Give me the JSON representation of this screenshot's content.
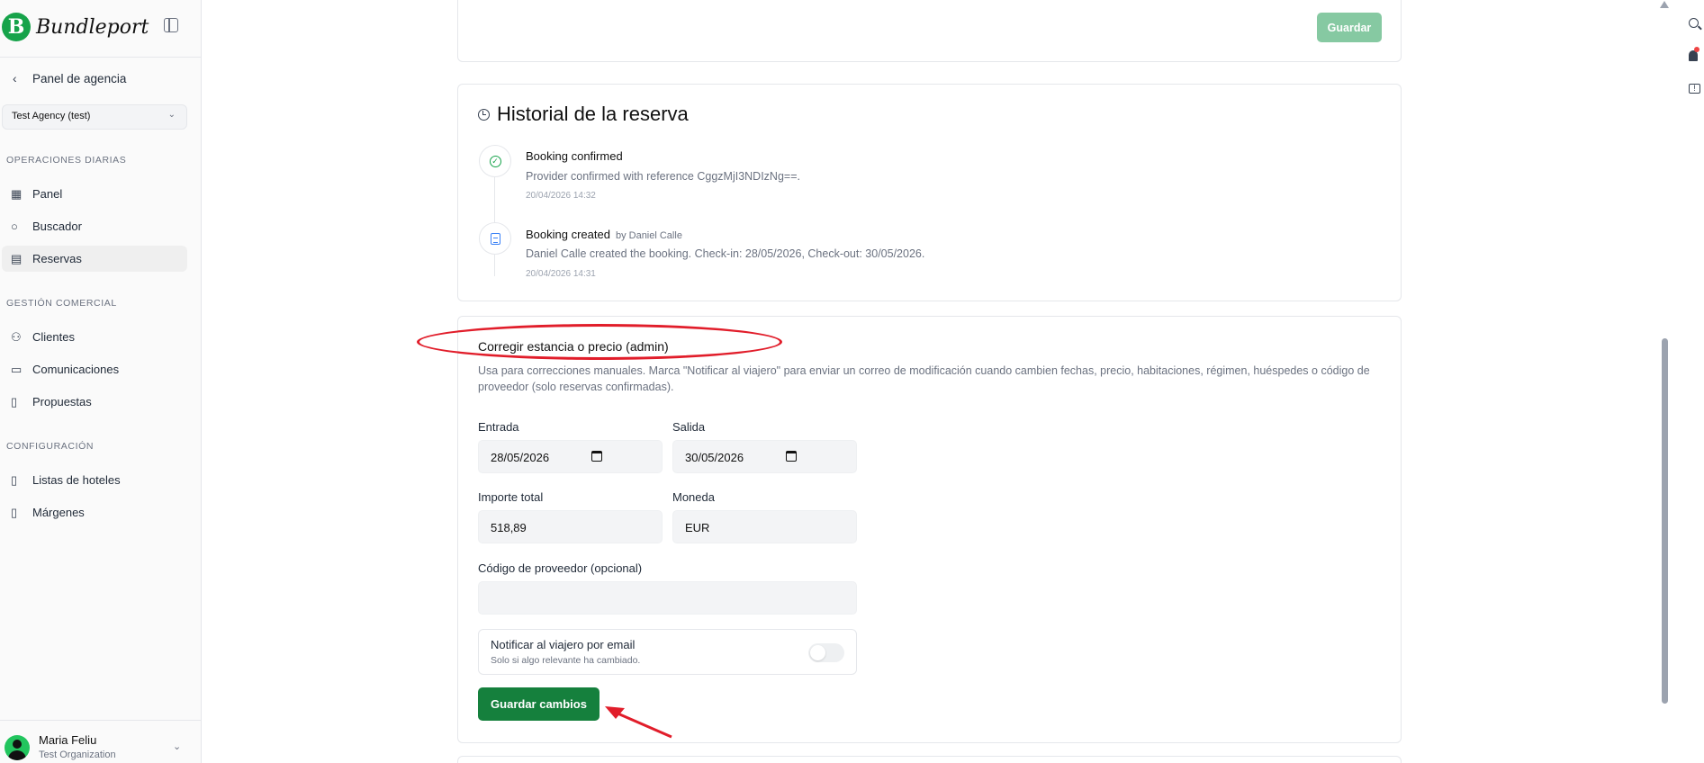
{
  "app": {
    "logo_letter": "B",
    "name": "Bundleport"
  },
  "sidebar": {
    "back_label": "Panel de agencia",
    "agency_select": "Test Agency (test)",
    "sections": {
      "daily": "OPERACIONES DIARIAS",
      "commercial": "GESTIÓN COMERCIAL",
      "config": "CONFIGURACIÓN"
    },
    "items": {
      "panel": "Panel",
      "buscador": "Buscador",
      "reservas": "Reservas",
      "clientes": "Clientes",
      "comunicaciones": "Comunicaciones",
      "propuestas": "Propuestas",
      "listas": "Listas de hoteles",
      "margenes": "Márgenes"
    },
    "active_item": "Reservas",
    "user": {
      "name": "Maria Feliu",
      "org": "Test Organization"
    }
  },
  "top_card": {
    "save_label": "Guardar"
  },
  "history": {
    "title": "Historial de la reserva",
    "events": [
      {
        "title": "Booking confirmed",
        "by": "",
        "description": "Provider confirmed with reference CggzMjI3NDIzNg==.",
        "time": "20/04/2026 14:32",
        "icon": "check-circle-icon"
      },
      {
        "title": "Booking created",
        "by": "by Daniel Calle",
        "description": "Daniel Calle created the booking. Check-in: 28/05/2026, Check-out: 30/05/2026.",
        "time": "20/04/2026 14:31",
        "icon": "document-icon"
      }
    ]
  },
  "fix_form": {
    "title": "Corregir estancia o precio (admin)",
    "description": "Usa para correcciones manuales. Marca \"Notificar al viajero\" para enviar un correo de modificación cuando cambien fechas, precio, habitaciones, régimen, huéspedes o código de proveedor (solo reservas confirmadas).",
    "entrada_label": "Entrada",
    "entrada_value": "28/05/2026",
    "salida_label": "Salida",
    "salida_value": "30/05/2026",
    "importe_label": "Importe total",
    "importe_value": "518,89",
    "moneda_label": "Moneda",
    "moneda_value": "EUR",
    "codigo_label": "Código de proveedor (opcional)",
    "codigo_value": "",
    "notify_title": "Notificar al viajero por email",
    "notify_sub": "Solo si algo relevante ha cambiado.",
    "notify_on": false,
    "save_label": "Guardar cambios"
  },
  "colors": {
    "brand": "#16a34a",
    "primary_button": "#15803d",
    "disabled_button": "#86c9a2",
    "annotation": "#e11d2a"
  }
}
